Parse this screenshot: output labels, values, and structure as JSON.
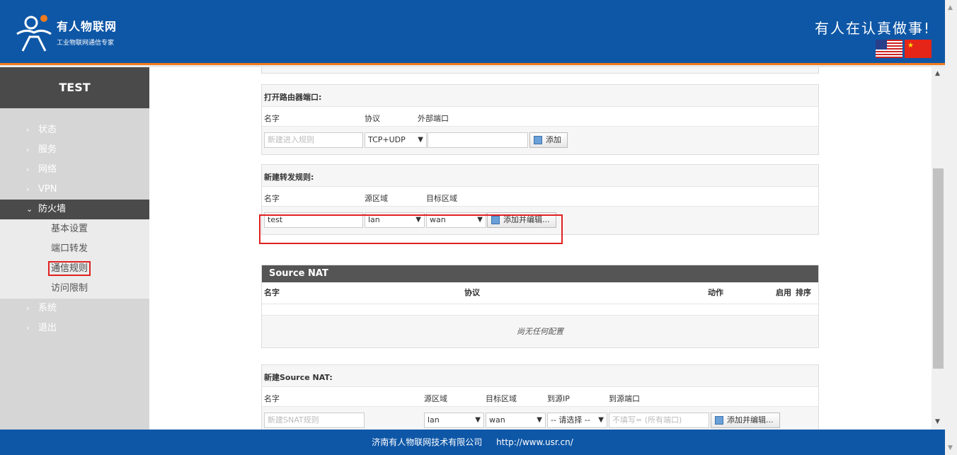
{
  "header": {
    "brand_name": "有人物联网",
    "brand_sub": "工业物联网通信专家",
    "slogan": "有人在认真做事!",
    "lang_icons": [
      "us-flag-icon",
      "cn-flag-icon"
    ]
  },
  "colors": {
    "header_bg": "#0e57a7",
    "accent": "#f07a1e",
    "highlight": "#e02020"
  },
  "sidebar": {
    "title": "TEST",
    "items": [
      {
        "label": "状态"
      },
      {
        "label": "服务"
      },
      {
        "label": "网络"
      },
      {
        "label": "VPN"
      },
      {
        "label": "防火墙",
        "open": true
      },
      {
        "label": "系统"
      },
      {
        "label": "退出"
      }
    ],
    "firewall_sub": [
      {
        "label": "基本设置"
      },
      {
        "label": "端口转发"
      },
      {
        "label": "通信规则",
        "active": true
      },
      {
        "label": "访问限制"
      }
    ]
  },
  "open_port": {
    "title": "打开路由器端口:",
    "col_name": "名字",
    "col_proto": "协议",
    "col_ext_port": "外部端口",
    "name_placeholder": "新建进入规则",
    "proto_value": "TCP+UDP",
    "add_label": "添加"
  },
  "forward": {
    "title": "新建转发规则:",
    "col_name": "名字",
    "col_src": "源区域",
    "col_dest": "目标区域",
    "name_value": "test",
    "src_value": "lan",
    "dest_value": "wan",
    "add_edit_label": "添加并编辑..."
  },
  "snat": {
    "title": "Source NAT",
    "col_name": "名字",
    "col_proto": "协议",
    "col_action": "动作",
    "col_enable": "启用",
    "col_sort": "排序",
    "empty_text": "尚无任何配置"
  },
  "new_snat": {
    "title": "新建Source NAT:",
    "col_name": "名字",
    "col_src": "源区域",
    "col_dest": "目标区域",
    "col_to_ip": "到源IP",
    "col_to_port": "到源端口",
    "name_placeholder": "新建SNAT规则",
    "src_value": "lan",
    "dest_value": "wan",
    "ip_value": "-- 请选择 --",
    "port_placeholder": "不填写= (所有端口)",
    "add_edit_label": "添加并编辑..."
  },
  "footer": {
    "company": "济南有人物联网技术有限公司",
    "url": "http://www.usr.cn/"
  }
}
